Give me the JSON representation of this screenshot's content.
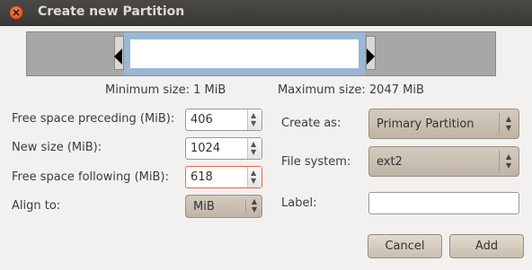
{
  "window": {
    "title": "Create new Partition"
  },
  "sizes": {
    "minimum": "Minimum size: 1 MiB",
    "maximum": "Maximum size: 2047 MiB"
  },
  "fields": {
    "free_preceding": {
      "label": "Free space preceding (MiB):",
      "value": "406"
    },
    "new_size": {
      "label": "New size (MiB):",
      "value": "1024"
    },
    "free_following": {
      "label": "Free space following (MiB):",
      "value": "618"
    },
    "align_to": {
      "label": "Align to:",
      "value": "MiB"
    },
    "create_as": {
      "label": "Create as:",
      "value": "Primary Partition"
    },
    "file_system": {
      "label": "File system:",
      "value": "ext2"
    },
    "partition_label": {
      "label": "Label:",
      "value": ""
    }
  },
  "buttons": {
    "cancel": "Cancel",
    "add": "Add"
  },
  "colors": {
    "close": "#d3431b",
    "titlebar": "#3c3b37",
    "partition": "#9bb7d4",
    "focus": "#e0674a"
  }
}
